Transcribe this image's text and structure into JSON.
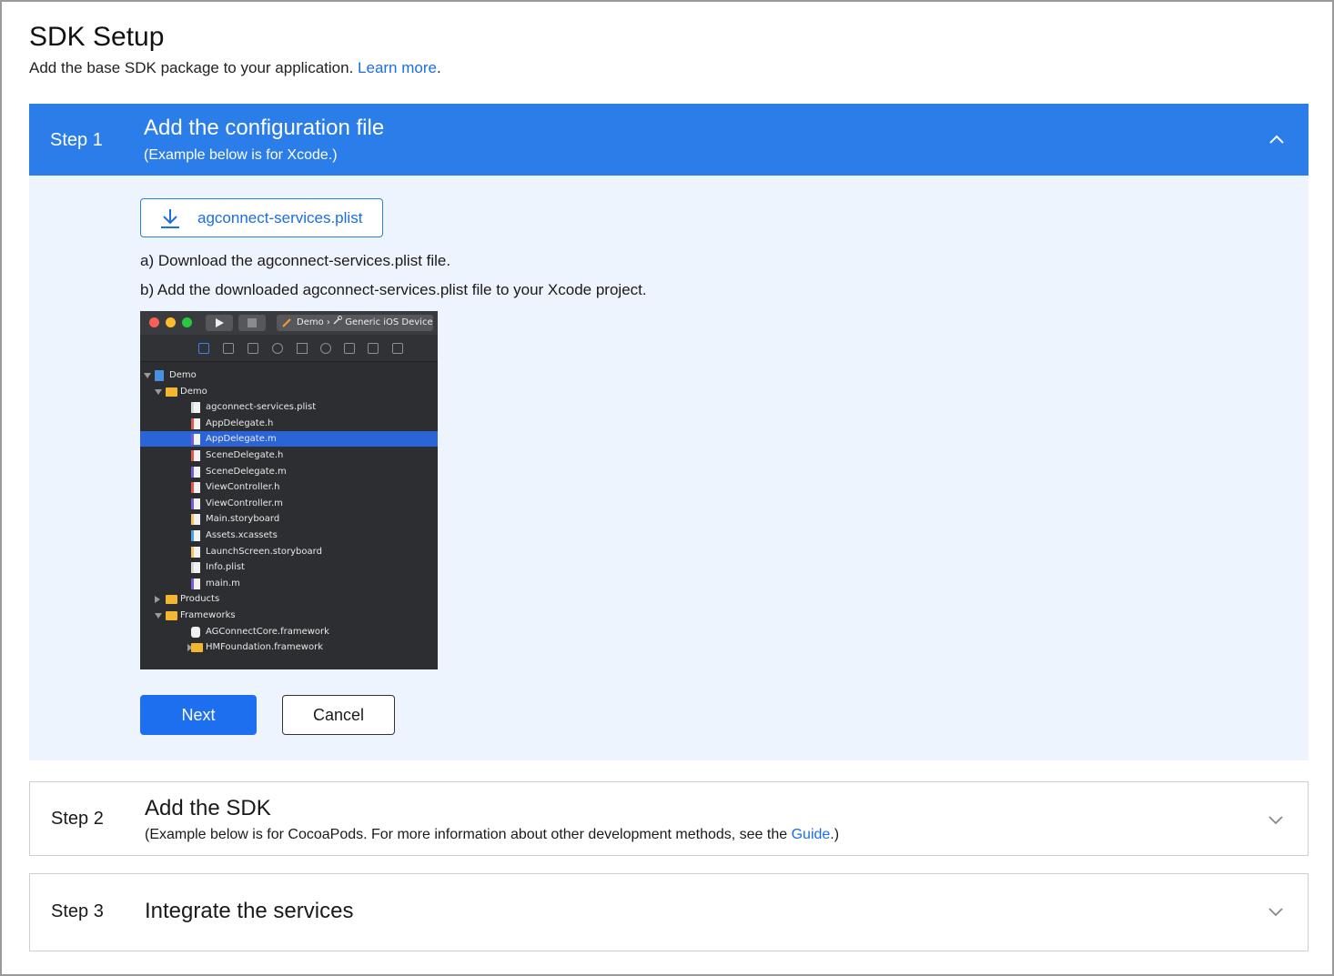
{
  "header": {
    "title": "SDK Setup",
    "subtitle_text": "Add the base SDK package to your application.",
    "learn_more": "Learn more",
    "subtitle_end": "."
  },
  "steps": [
    {
      "number": "Step 1",
      "title": "Add the configuration file",
      "desc": "(Example below is for Xcode.)",
      "expanded": true,
      "download_label": "agconnect-services.plist",
      "instructions": [
        "a) Download the agconnect-services.plist file.",
        "b) Add the downloaded agconnect-services.plist file to your Xcode project."
      ],
      "next_label": "Next",
      "cancel_label": "Cancel"
    },
    {
      "number": "Step 2",
      "title": "Add the SDK",
      "desc_prefix": "(Example below is for CocoaPods. For more information about other development methods, see the ",
      "desc_link": "Guide",
      "desc_suffix": ".)",
      "expanded": false
    },
    {
      "number": "Step 3",
      "title": "Integrate the services",
      "expanded": false
    }
  ],
  "xcode": {
    "scheme": "Demo",
    "scheme_sep": "›",
    "device": "Generic iOS Device",
    "tree": [
      {
        "label": "Demo",
        "indent": 0,
        "kind": "project",
        "tri": "down"
      },
      {
        "label": "Demo",
        "indent": 1,
        "kind": "folder",
        "tri": "down"
      },
      {
        "label": "agconnect-services.plist",
        "indent": 2,
        "kind": "plist"
      },
      {
        "label": "AppDelegate.h",
        "indent": 2,
        "kind": "h"
      },
      {
        "label": "AppDelegate.m",
        "indent": 2,
        "kind": "m",
        "selected": true
      },
      {
        "label": "SceneDelegate.h",
        "indent": 2,
        "kind": "h"
      },
      {
        "label": "SceneDelegate.m",
        "indent": 2,
        "kind": "m"
      },
      {
        "label": "ViewController.h",
        "indent": 2,
        "kind": "h"
      },
      {
        "label": "ViewController.m",
        "indent": 2,
        "kind": "m"
      },
      {
        "label": "Main.storyboard",
        "indent": 2,
        "kind": "storyboard"
      },
      {
        "label": "Assets.xcassets",
        "indent": 2,
        "kind": "assets"
      },
      {
        "label": "LaunchScreen.storyboard",
        "indent": 2,
        "kind": "storyboard"
      },
      {
        "label": "Info.plist",
        "indent": 2,
        "kind": "plist"
      },
      {
        "label": "main.m",
        "indent": 2,
        "kind": "m"
      },
      {
        "label": "Products",
        "indent": 1,
        "kind": "folder",
        "tri": "right"
      },
      {
        "label": "Frameworks",
        "indent": 1,
        "kind": "folder",
        "tri": "down"
      },
      {
        "label": "AGConnectCore.framework",
        "indent": 2,
        "kind": "framework"
      },
      {
        "label": "HMFoundation.framework",
        "indent": 2,
        "kind": "framework-folder",
        "tri": "right"
      }
    ]
  },
  "colors": {
    "accent": "#2b7de9",
    "step_body_bg": "#eef4fe",
    "link": "#1a6ee8",
    "xcode_selection": "#2a64d6"
  }
}
